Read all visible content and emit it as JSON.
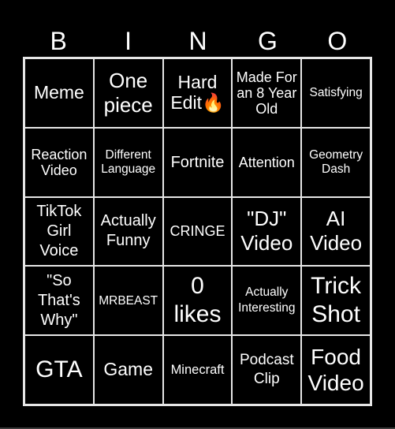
{
  "header": {
    "letters": [
      "B",
      "I",
      "N",
      "G",
      "O"
    ]
  },
  "board": {
    "cells": [
      [
        "Meme",
        "One piece",
        "Hard Edit🔥",
        "Made For an 8 Year Old",
        "Satisfying"
      ],
      [
        "Reaction Video",
        "Different Language",
        "Fortnite",
        "Attention",
        "Geometry Dash"
      ],
      [
        "TikTok Girl Voice",
        "Actually Funny",
        "CRINGE",
        "\"DJ\" Video",
        "AI Video"
      ],
      [
        "\"So That's Why\"",
        "MRBEAST",
        "0 likes",
        "Actually Interesting",
        "Trick Shot"
      ],
      [
        "GTA",
        "Game",
        "Minecraft",
        "Podcast Clip",
        "Food Video"
      ]
    ]
  },
  "colors": {
    "background": "#000000",
    "grid": "#e6e6e6",
    "text": "#ffffff"
  }
}
